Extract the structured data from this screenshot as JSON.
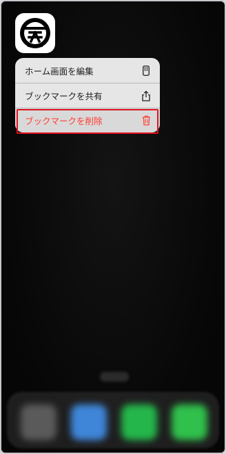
{
  "menu": {
    "items": [
      {
        "label": "ホーム画面を編集",
        "icon": "phone-edit-icon"
      },
      {
        "label": "ブックマークを共有",
        "icon": "share-icon"
      },
      {
        "label": "ブックマークを削除",
        "icon": "trash-icon"
      }
    ]
  },
  "colors": {
    "destructive": "#ff3b30",
    "highlight_border": "#e0121f",
    "menu_background": "#e6e6e6"
  },
  "dock": {
    "apps": [
      "blurred-app-icon",
      "safari-icon",
      "phone-icon",
      "messages-icon"
    ]
  },
  "app_icon": "bookmark-app-logo-icon"
}
